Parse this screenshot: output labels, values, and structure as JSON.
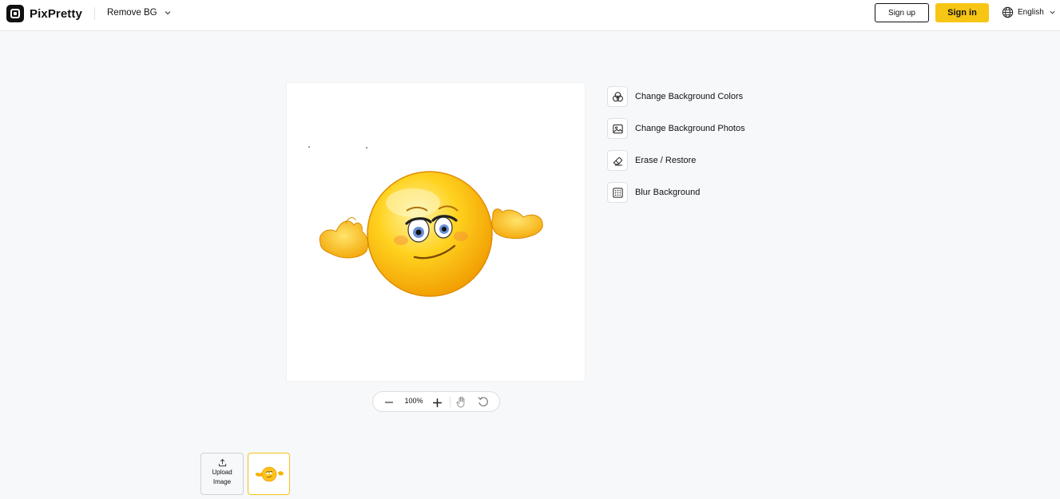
{
  "header": {
    "brand": "PixPretty",
    "tool_menu_label": "Remove BG",
    "signup_label": "Sign up",
    "signin_label": "Sign in",
    "language_label": "English"
  },
  "zoom": {
    "level": "100%"
  },
  "actions": [
    {
      "label": "Change Background Colors",
      "icon": "color-circles-icon"
    },
    {
      "label": "Change Background Photos",
      "icon": "image-icon"
    },
    {
      "label": "Erase / Restore",
      "icon": "eraser-icon"
    },
    {
      "label": "Blur Background",
      "icon": "blur-grid-icon"
    }
  ],
  "upload": {
    "line1": "Upload",
    "line2": "Image"
  },
  "colors": {
    "accent": "#f7c514",
    "background": "#f7f8fa",
    "text": "#111111"
  }
}
